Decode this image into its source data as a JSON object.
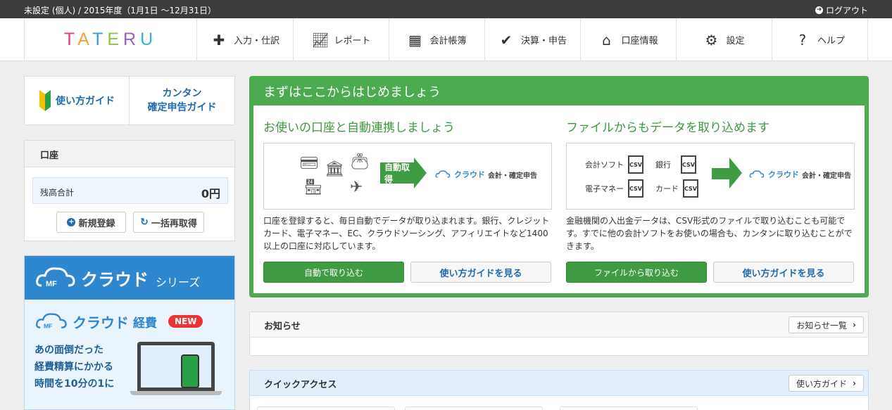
{
  "topbar": {
    "fiscal_year": "未設定 (個人) / 2015年度（1月1日 ～12月31日）",
    "logout_label": "ログアウト"
  },
  "brand": {
    "name": "TATERU"
  },
  "nav": {
    "items": [
      {
        "label": "入力・仕訳",
        "icon": "plus-minus-icon"
      },
      {
        "label": "レポート",
        "icon": "chart-icon"
      },
      {
        "label": "会計帳簿",
        "icon": "grid-icon"
      },
      {
        "label": "決算・申告",
        "icon": "check-icon"
      },
      {
        "label": "口座情報",
        "icon": "home-icon"
      },
      {
        "label": "設定",
        "icon": "gear-icon"
      },
      {
        "label": "ヘルプ",
        "icon": "question-icon"
      }
    ]
  },
  "guide": {
    "usage_label": "使い方ガイド",
    "tax_label_line1": "カンタン",
    "tax_label_line2": "確定申告ガイド"
  },
  "account": {
    "title": "口座",
    "total_label": "残高合計",
    "total_value": "0円",
    "new_button": "新規登録",
    "refresh_button": "一括再取得"
  },
  "banner": {
    "brand": "クラウド",
    "series": "シリーズ",
    "sub_brand": "クラウド",
    "sub_product": "経費",
    "new_badge": "NEW",
    "copy_line1": "あの面倒だった",
    "copy_line2": "経費精算にかかる",
    "copy_line3": "時間を10分の1に"
  },
  "start": {
    "title": "まずはここからはじめましょう",
    "left": {
      "heading": "お使いの口座と自動連携しましょう",
      "arrow_label": "自動取得",
      "mf_label": "クラウド",
      "mf_sub": "会計・確定申告",
      "description": "口座を登録すると、毎日自動でデータが取り込まれます。銀行、クレジットカード、電子マネー、EC、クラウドソーシング、アフィリエイトなど1400以上の口座に対応しています。",
      "primary_button": "自動で取り込む",
      "secondary_button": "使い方ガイドを見る"
    },
    "right": {
      "heading": "ファイルからもデータを取り込めます",
      "sources": [
        "会計ソフト",
        "銀行",
        "電子マネー",
        "カード"
      ],
      "csv_label": "CSV",
      "mf_label": "クラウド",
      "mf_sub": "会計・確定申告",
      "description": "金融機関の入出金データは、CSV形式のファイルで取り込むことも可能です。すでに他の会計ソフトをお使いの場合も、カンタンに取り込むことができます。",
      "primary_button": "ファイルから取り込む",
      "secondary_button": "使い方ガイドを見る"
    }
  },
  "news": {
    "title": "お知らせ",
    "list_button": "お知らせ一覧"
  },
  "quick": {
    "title": "クイックアクセス",
    "guide_button": "使い方ガイド"
  },
  "colors": {
    "green": "#4cab4f",
    "blue": "#2e87cf",
    "dark": "#3c3c3c"
  }
}
